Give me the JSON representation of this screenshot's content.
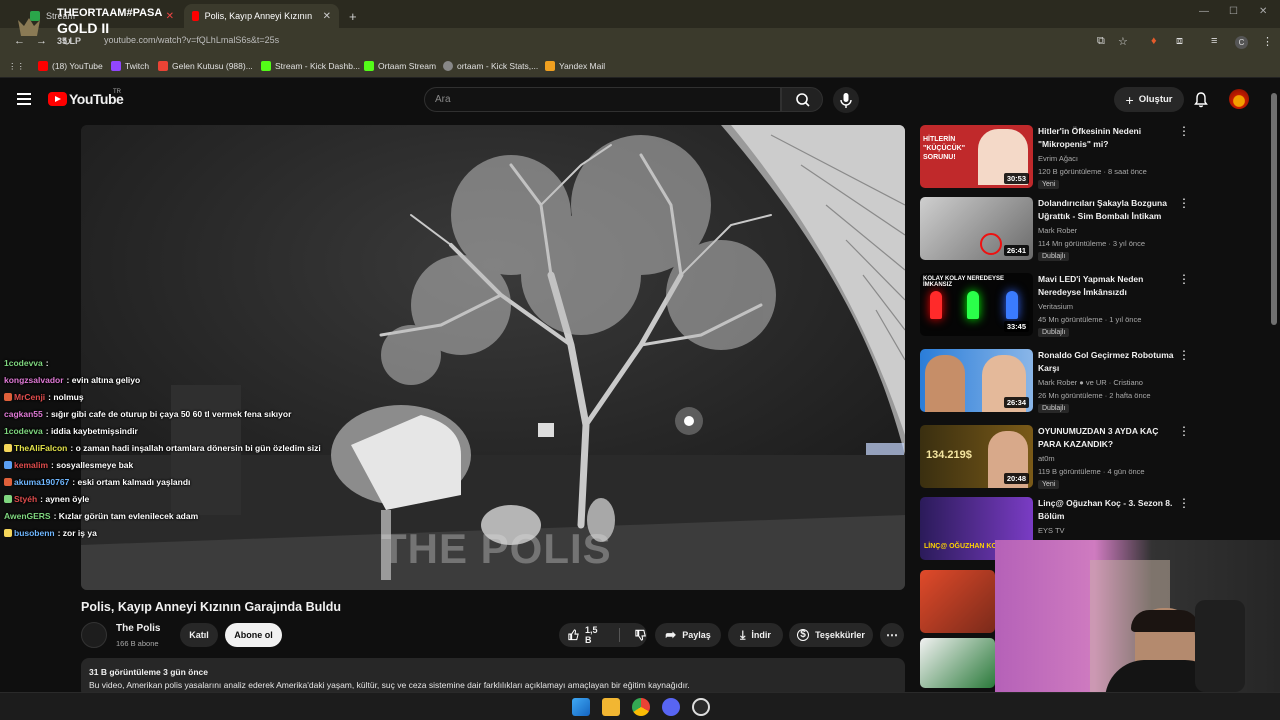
{
  "browser": {
    "tabs": [
      {
        "label": "Stream",
        "active": false
      },
      {
        "label": "Polis, Kayıp Anneyi Kızının Garajında Buldu",
        "active": true
      }
    ],
    "new_tab": "+",
    "url": "youtube.com/watch?v=fQLhLmalS6s&t=25s",
    "bookmarks": [
      {
        "label": "(18) YouTube"
      },
      {
        "label": "Twitch"
      },
      {
        "label": "Gelen Kutusu (988)..."
      },
      {
        "label": "Stream - Kick Dashb..."
      },
      {
        "label": "Ortaam Stream"
      },
      {
        "label": "ortaam - Kick Stats,..."
      },
      {
        "label": "Yandex Mail"
      }
    ],
    "profile_initial": "C"
  },
  "overlay": {
    "name": "THEORTAAM#PASA",
    "rank": "GOLD II",
    "lp": "35 LP"
  },
  "youtube": {
    "logo_text": "YouTube",
    "country": "TR",
    "search_placeholder": "Ara",
    "create_label": "Oluştur"
  },
  "video": {
    "watermark": "THE POLIS",
    "title": "Polis, Kayıp Anneyi Kızının Garajında Buldu",
    "channel": "The Polis",
    "subscribers": "166 B abone",
    "join_label": "Katıl",
    "subscribe_label": "Abone ol",
    "likes": "1,5 B",
    "share_label": "Paylaş",
    "download_label": "İndir",
    "thanks_label": "Teşekkürler",
    "views_date": "31 B görüntüleme  3 gün önce",
    "description": "Bu video, Amerikan polis yasalarını analiz ederek Amerika'daki yaşam, kültür, suç ve ceza sistemine dair farklılıkları açıklamayı amaçlayan bir eğitim kaynağıdır."
  },
  "chat": [
    {
      "user": "1codevva",
      "msg": ":",
      "color": "#7fd67f"
    },
    {
      "user": "kongzsalvador",
      "msg": ": evin altına geliyo",
      "color": "#e07ad6"
    },
    {
      "user": "MrCenji",
      "msg": ": nolmuş",
      "color": "#e04d4d"
    },
    {
      "user": "cagkan55",
      "msg": ": sığır gibi cafe de oturup bi çaya 50 60 tl vermek fena sıkıyor",
      "color": "#e07ad6"
    },
    {
      "user": "1codevva",
      "msg": ": iddia kaybetmişsindir",
      "color": "#7fd67f"
    },
    {
      "user": "TheAliFalcon",
      "msg": ": o zaman hadi inşallah ortamlara dönersin bi gün özledim sizi",
      "color": "#e3e34a"
    },
    {
      "user": "kemalim",
      "msg": ": sosyallesmeye bak",
      "color": "#e04d4d"
    },
    {
      "user": "akuma190767",
      "msg": ": eski ortam kalmadı yaşlandı",
      "color": "#6fb7ff"
    },
    {
      "user": "Styéh",
      "msg": ": aynen öyle",
      "color": "#e04d4d"
    },
    {
      "user": "AwenGERS",
      "msg": ": Kızlar görün tam evlenilecek adam",
      "color": "#7fd67f"
    },
    {
      "user": "busobenn",
      "msg": ": zor iş ya",
      "color": "#6fb7ff"
    }
  ],
  "recommendations": [
    {
      "title": "Hitler'in Öfkesinin Nedeni \"Mikropenis\" mi?",
      "channel": "Evrim Ağacı",
      "views": "120 B görüntüleme · 8 saat önce",
      "badge": "Yeni",
      "duration": "30:53",
      "thumb_text": "HİTLERİN \"KÜÇÜCÜK\" SORUNU!"
    },
    {
      "title": "Dolandırıcıları Şakayla Bozguna Uğrattık - Sim Bombalı İntikam",
      "channel": "Mark Rober",
      "views": "114 Mn görüntüleme · 3 yıl önce",
      "badge": "Dublajlı",
      "duration": "26:41",
      "thumb_text": ""
    },
    {
      "title": "Mavi LED'i Yapmak Neden Neredeyse İmkânsızdı",
      "channel": "Veritasium",
      "views": "45 Mn görüntüleme · 1 yıl önce",
      "badge": "Dublajlı",
      "duration": "33:45",
      "thumb_text": "KOLAY  KOLAY  NEREDEYSE İMKANSIZ"
    },
    {
      "title": "Ronaldo Gol Geçirmez Robotuma Karşı",
      "channel": "Mark Rober ● ve UR · Cristiano",
      "views": "26 Mn görüntüleme · 2 hafta önce",
      "badge": "Dublajlı",
      "duration": "26:34",
      "thumb_text": ""
    },
    {
      "title": "OYUNUMUZDAN 3 AYDA KAÇ PARA KAZANDIK?",
      "channel": "at0m",
      "views": "119 B görüntüleme · 4 gün önce",
      "badge": "Yeni",
      "duration": "20:48",
      "thumb_text": "134.219$"
    },
    {
      "title": "Linç@ Oğuzhan Koç - 3. Sezon 8. Bölüm",
      "channel": "EYS TV",
      "views": "",
      "badge": "",
      "duration": "",
      "thumb_text": "LİNÇ@  OĞUZHAN KOÇ"
    }
  ],
  "colors": {
    "brand": "#ff0000",
    "bg": "#0f0f0f",
    "chrome": "#3b3a2c"
  }
}
